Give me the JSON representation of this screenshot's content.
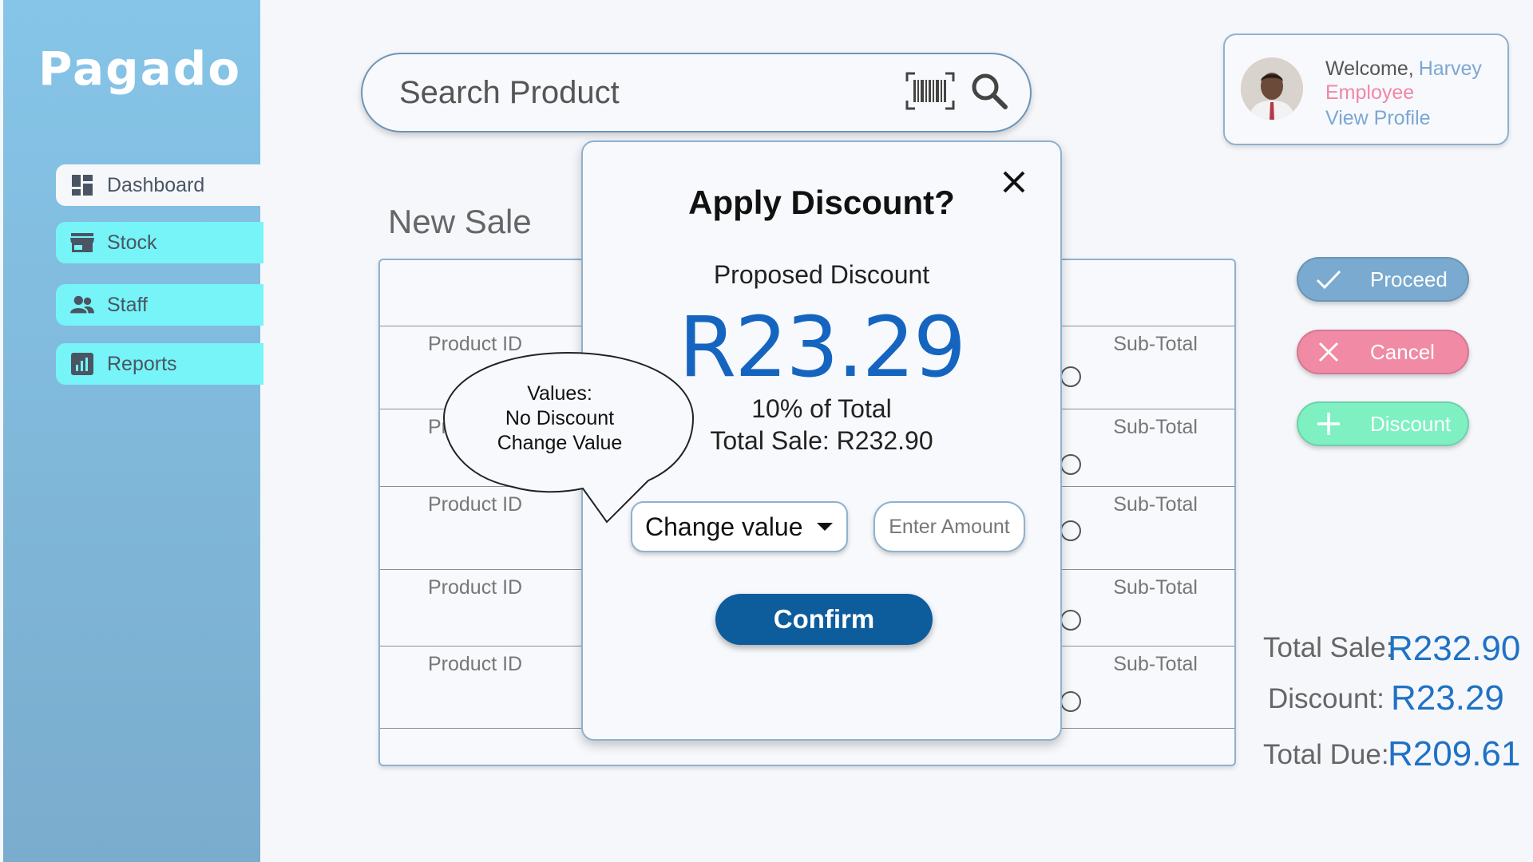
{
  "app": {
    "logo": "Pagado"
  },
  "sidebar": {
    "items": [
      {
        "label": "Dashboard"
      },
      {
        "label": "Stock"
      },
      {
        "label": "Staff"
      },
      {
        "label": "Reports"
      }
    ]
  },
  "search": {
    "placeholder": "Search Product"
  },
  "profile": {
    "welcome": "Welcome,",
    "name": "Harvey",
    "role": "Employee",
    "view_profile": "View Profile"
  },
  "page": {
    "title": "New Sale"
  },
  "table": {
    "rows": [
      {
        "product": "Product ID",
        "subtotal": "Sub-Total"
      },
      {
        "product": "Product ID",
        "subtotal": "Sub-Total"
      },
      {
        "product": "Product ID",
        "subtotal": "Sub-Total"
      },
      {
        "product": "Product ID",
        "subtotal": "Sub-Total"
      },
      {
        "product": "Product ID",
        "subtotal": "Sub-Total"
      }
    ]
  },
  "actions": {
    "proceed": "Proceed",
    "cancel": "Cancel",
    "discount": "Discount"
  },
  "totals": {
    "total_sale_label": "Total Sale:",
    "total_sale_value": "R232.90",
    "discount_label": "Discount:",
    "discount_value": "R23.29",
    "total_due_label": "Total Due:",
    "total_due_value": "R209.61"
  },
  "modal": {
    "title": "Apply Discount?",
    "proposed_label": "Proposed Discount",
    "amount": "R23.29",
    "percent_text": "10% of Total",
    "total_sale_text": "Total Sale: R232.90",
    "select_value": "Change value",
    "amount_placeholder": "Enter Amount",
    "confirm": "Confirm"
  },
  "bubble": {
    "line1": "Values:",
    "line2": "No Discount",
    "line3": "Change Value"
  },
  "colors": {
    "accent": "#1565c0",
    "confirm": "#0d5c9c",
    "proceed": "#7aaacf",
    "cancel": "#f08aa5",
    "discount": "#7ef0c1",
    "nav_highlight": "#76f4f8"
  },
  "icons": {
    "search": "search-icon",
    "barcode": "barcode-icon",
    "dashboard": "dashboard-icon",
    "stock": "store-icon",
    "staff": "people-icon",
    "reports": "chart-icon",
    "close": "close-icon"
  }
}
